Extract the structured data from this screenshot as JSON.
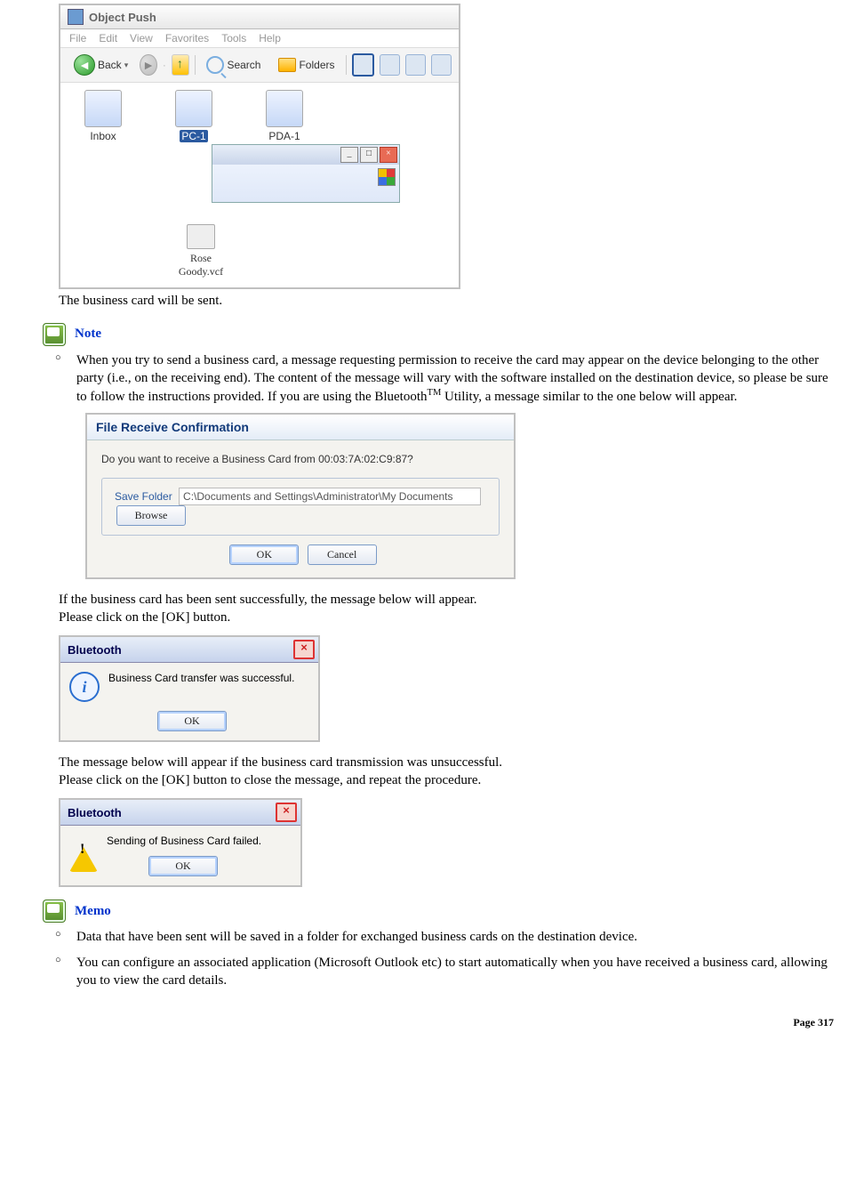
{
  "scr1": {
    "window_title": "Object Push",
    "menu": [
      "File",
      "Edit",
      "View",
      "Favorites",
      "Tools",
      "Help"
    ],
    "toolbar": {
      "back": "Back",
      "search": "Search",
      "folders": "Folders"
    },
    "desktop_icons": {
      "inbox": "Inbox",
      "pc1": "PC-1",
      "pda1": "PDA-1"
    },
    "vcf_label_line1": "Rose",
    "vcf_label_line2": "Goody.vcf"
  },
  "body": {
    "after_scr1": "The business card will be sent.",
    "note_label": "Note",
    "note_bullet_1_a": "When you try to send a business card, a message requesting permission to receive the card may appear on the device belonging to the other party (i.e., on the receiving end). The content of the message will vary with the software installed on the destination device, so please be sure to follow the instructions provided. If you are using the Bluetooth",
    "note_bullet_1_tm": "TM",
    "note_bullet_1_b": " Utility, a message similar to the one below will appear.",
    "after_dialog_l1": "If the business card has been sent successfully, the message below will appear.",
    "after_dialog_l2": "Please click on the [OK] button.",
    "after_msg1_l1": "The message below will appear if the business card transmission was unsuccessful.",
    "after_msg1_l2": "Please click on the [OK] button to close the message, and repeat the procedure.",
    "memo_label": "Memo",
    "memo_b1": "Data that have been sent will be saved in a folder for exchanged business cards on the destination device.",
    "memo_b2": "You can configure an associated application (Microsoft Outlook etc) to start automatically when you have received a business card, allowing you to view the card details."
  },
  "dialog": {
    "title": "File Receive Confirmation",
    "question": "Do you want to receive a Business Card from 00:03:7A:02:C9:87?",
    "legend": "Save Folder",
    "path": "C:\\Documents and Settings\\Administrator\\My Documents",
    "browse": "Browse",
    "ok": "OK",
    "cancel": "Cancel"
  },
  "msg_success": {
    "title": "Bluetooth",
    "text": "Business Card transfer was successful.",
    "ok": "OK"
  },
  "msg_fail": {
    "title": "Bluetooth",
    "text": "Sending of Business Card failed.",
    "ok": "OK"
  },
  "page": {
    "label": "Page",
    "num": "317"
  }
}
